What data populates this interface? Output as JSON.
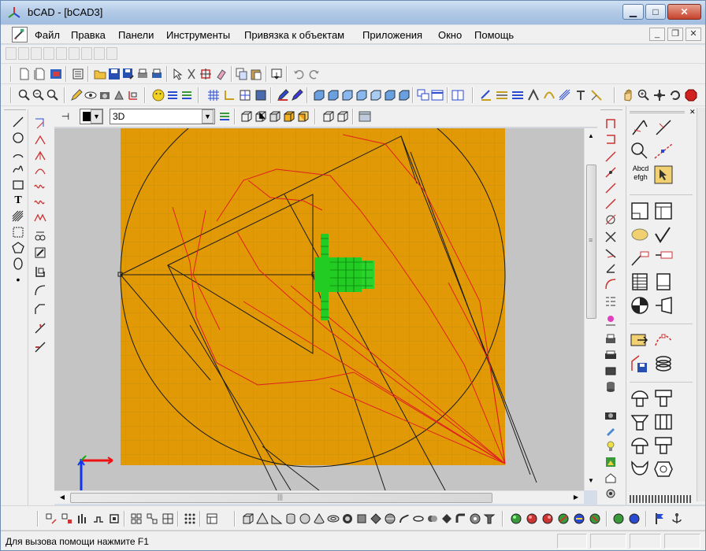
{
  "window": {
    "title": "bCAD - [bCAD3]",
    "minimize": "▁",
    "maximize": "□",
    "close": "✕",
    "mdi_minimize": "_",
    "mdi_restore": "❐",
    "mdi_close": "✕"
  },
  "menu": {
    "items": [
      "Файл",
      "Правка",
      "Панели",
      "Инструменты",
      "Привязка к объектам",
      "Приложения",
      "Окно",
      "Помощь"
    ]
  },
  "layer_bar": {
    "layer_value": "3D",
    "dropdown_arrow": "▼",
    "pin_glyph": "⊣"
  },
  "hscroll": {
    "left_arrow": "◀",
    "right_arrow": "▶",
    "thumb_grip": "|||"
  },
  "vscroll": {
    "up_arrow": "▲",
    "down_arrow": "▼",
    "thumb_grip": "≡"
  },
  "left_toolbar": {
    "text_tool": "T",
    "point_tool": "•"
  },
  "right_panel": {
    "text_tool_label": "Abcd\nefgh"
  },
  "status": {
    "help_text": "Для вызова помощи нажмите F1"
  },
  "colors": {
    "sheet": "#e19a05",
    "sheet_grid": "#c88a10",
    "canvas_bg": "#c4c4c4",
    "red_lines": "#e02020",
    "black_lines": "#1a1a1a",
    "green_part": "#22cc22",
    "axis_red": "#ee1111",
    "axis_blue": "#1133ee",
    "axis_green": "#11aa11"
  }
}
